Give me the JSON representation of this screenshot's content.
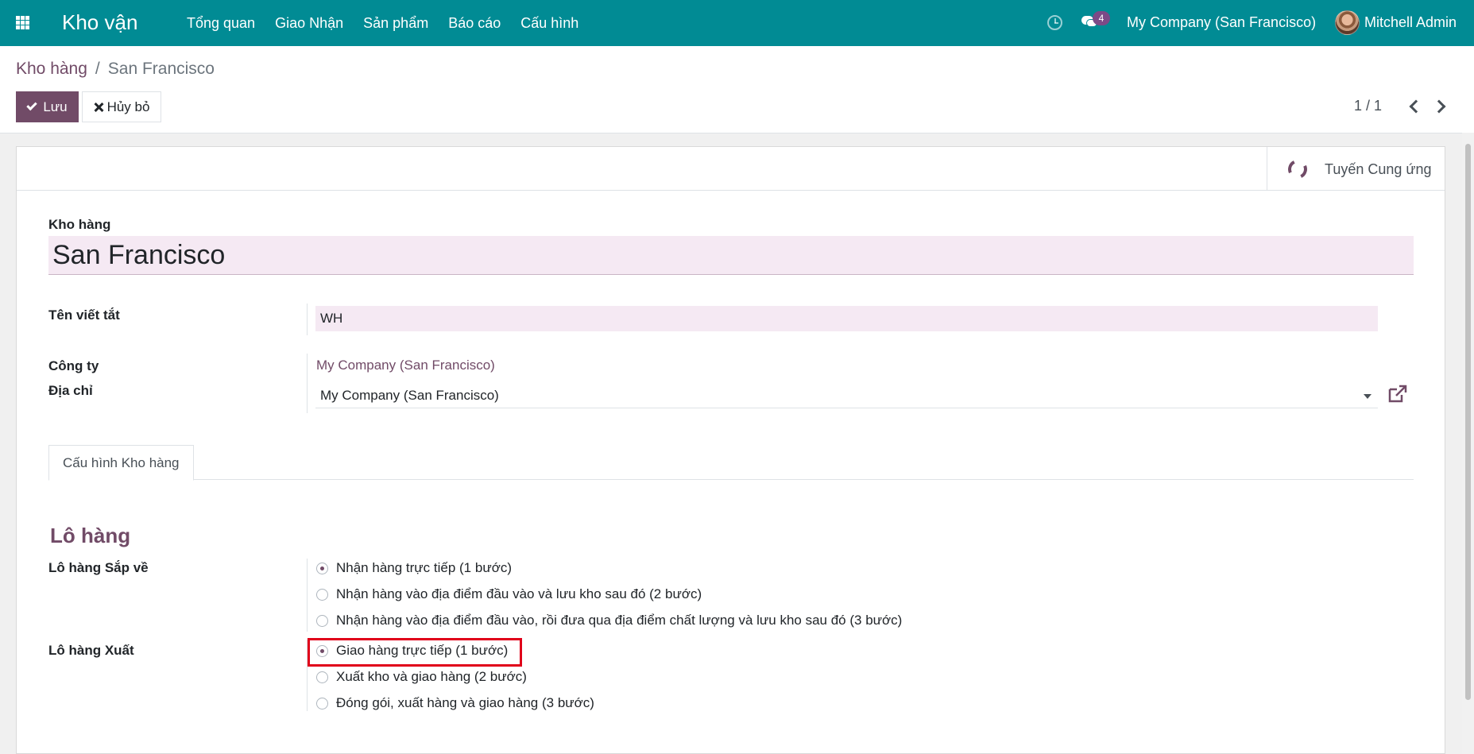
{
  "navbar": {
    "app_name": "Kho vận",
    "menu": [
      "Tổng quan",
      "Giao Nhận",
      "Sản phẩm",
      "Báo cáo",
      "Cấu hình"
    ],
    "messages_count": "4",
    "company": "My Company (San Francisco)",
    "user": "Mitchell Admin",
    "accent_color": "#018b94"
  },
  "breadcrumb": {
    "parent": "Kho hàng",
    "separator": "/",
    "current": "San Francisco"
  },
  "actions": {
    "save_label": "Lưu",
    "cancel_label": "Hủy bỏ"
  },
  "pager": {
    "value": "1 / 1"
  },
  "smart_button": {
    "label": "Tuyến Cung ứng"
  },
  "form": {
    "name_label": "Kho hàng",
    "name_value": "San Francisco",
    "short_name_label": "Tên viết tắt",
    "short_name_value": "WH",
    "company_label": "Công ty",
    "company_value": "My Company (San Francisco)",
    "address_label": "Địa chỉ",
    "address_value": "My Company (San Francisco)"
  },
  "tabs": {
    "config": "Cấu hình Kho hàng"
  },
  "shipments": {
    "title": "Lô hàng",
    "incoming_label": "Lô hàng Sắp về",
    "incoming_options": [
      "Nhận hàng trực tiếp (1 bước)",
      "Nhận hàng vào địa điểm đầu vào và lưu kho sau đó (2 bước)",
      "Nhận hàng vào địa điểm đầu vào, rồi đưa qua địa điểm chất lượng và lưu kho sau đó (3 bước)"
    ],
    "outgoing_label": "Lô hàng Xuất",
    "outgoing_options": [
      "Giao hàng trực tiếp (1 bước)",
      "Xuất kho và giao hàng (2 bước)",
      "Đóng gói, xuất hàng và giao hàng (3 bước)"
    ],
    "accent_color": "#714b67"
  }
}
